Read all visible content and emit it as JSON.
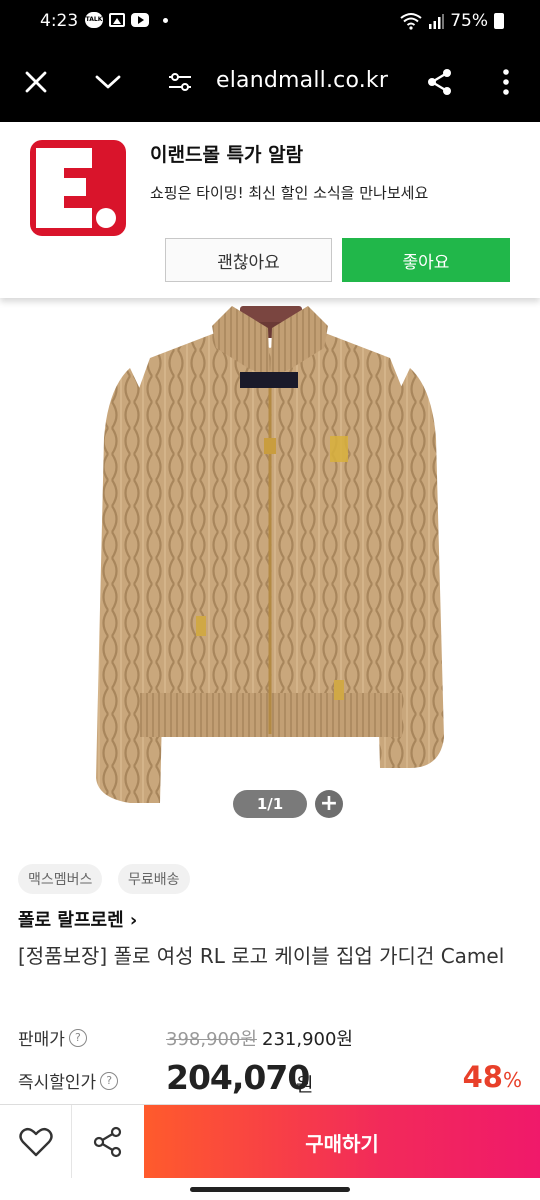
{
  "status_bar": {
    "time": "4:23",
    "talk_badge": "TALK",
    "battery": "75%"
  },
  "browser": {
    "url": "elandmall.co.kr",
    "icons": [
      "close-icon",
      "chevron-down-icon",
      "tune-icon",
      "share-icon",
      "more-vert-icon"
    ]
  },
  "banner": {
    "logo_letter": "E.",
    "title": "이랜드몰 특가 알람",
    "subtitle": "쇼핑은 타이밍! 최신 할인 소식을 만나보세요",
    "decline_label": "괜찮아요",
    "accept_label": "좋아요",
    "accept_color": "#21b74a",
    "brand_color": "#d9142b"
  },
  "product": {
    "image_counter": "1/1",
    "zoom_label": "+",
    "tags": [
      "맥스멤버스",
      "무료배송"
    ],
    "brand": "폴로 랄프로렌 ›",
    "name": "[정품보장] 폴로 여성 RL 로고 케이블 집업 가디건 Camel",
    "price_label": "판매가",
    "original_price": "398,900원",
    "sale_price": "231,900원",
    "discount_label": "즉시할인가",
    "discount_price": "204,070",
    "discount_unit": "원",
    "discount_rate": "48",
    "discount_rate_unit": "%",
    "discount_color": "#e8402a"
  },
  "bottom_bar": {
    "buy_label": "구매하기"
  }
}
